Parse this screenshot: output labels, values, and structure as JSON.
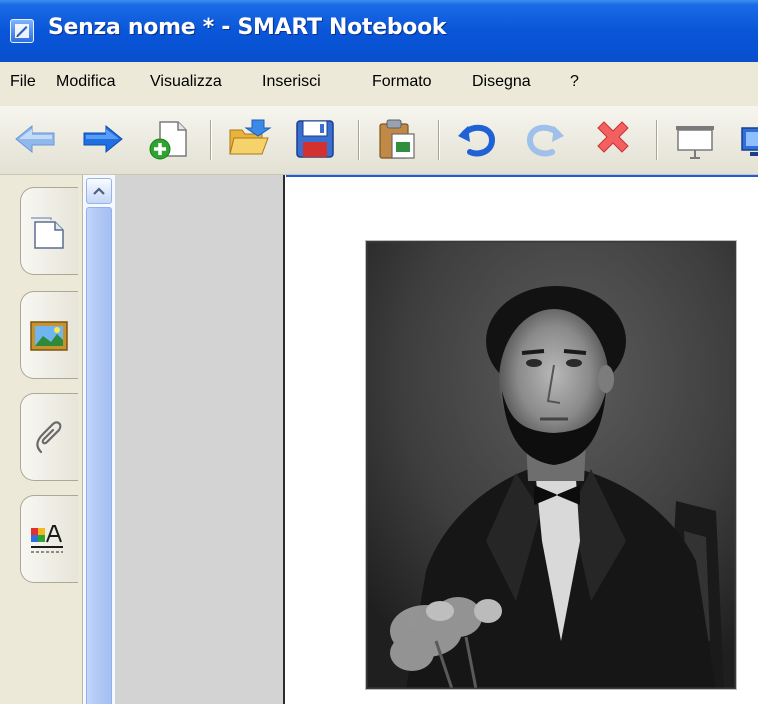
{
  "window": {
    "title": "Senza nome * - SMART Notebook"
  },
  "menu": {
    "items": [
      "File",
      "Modifica",
      "Visualizza",
      "Inserisci",
      "Formato",
      "Disegna",
      "?"
    ]
  },
  "toolbar": {
    "buttons": [
      {
        "name": "back-arrow-icon"
      },
      {
        "name": "forward-arrow-icon"
      },
      {
        "name": "add-page-icon"
      },
      {
        "name": "open-folder-icon"
      },
      {
        "name": "save-disk-icon"
      },
      {
        "name": "paste-icon"
      },
      {
        "name": "undo-icon"
      },
      {
        "name": "redo-icon"
      },
      {
        "name": "delete-x-icon"
      },
      {
        "name": "screen-shade-icon"
      }
    ]
  },
  "side_tabs": [
    {
      "name": "page-sorter-tab",
      "icon": "page-icon"
    },
    {
      "name": "gallery-tab",
      "icon": "picture-icon"
    },
    {
      "name": "attachments-tab",
      "icon": "paperclip-icon"
    },
    {
      "name": "properties-tab",
      "icon": "properties-icon"
    }
  ],
  "colors": {
    "title_bar": "#0a56d8",
    "menu_bg": "#ece9d8",
    "sorter_bg": "#d3d3d3",
    "scroll_thumb": "#b3caf7"
  }
}
